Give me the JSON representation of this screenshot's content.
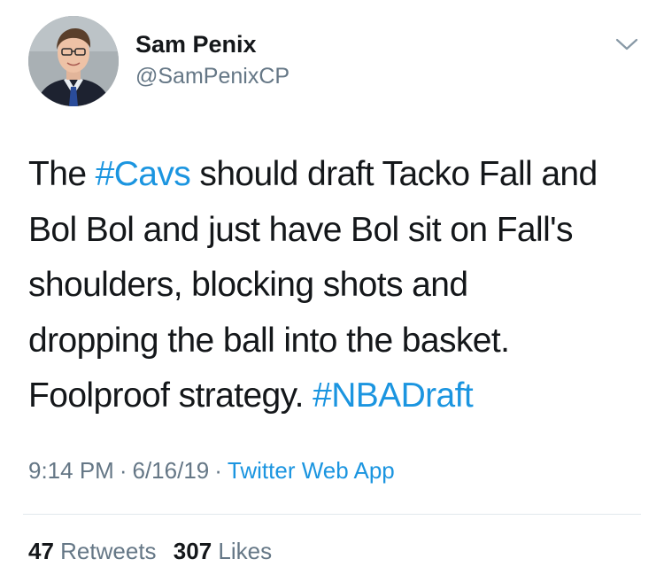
{
  "author": {
    "display_name": "Sam Penix",
    "handle": "@SamPenixCP",
    "avatar_icon": "profile-photo"
  },
  "menu": {
    "icon": "chevron-down-icon"
  },
  "tweet": {
    "lines": [
      [
        {
          "t": "The "
        },
        {
          "t": "#Cavs",
          "tag": true
        },
        {
          "t": " should draft Tacko Fall and"
        }
      ],
      [
        {
          "t": "Bol Bol and just have Bol sit on Fall's"
        }
      ],
      [
        {
          "t": "shoulders, blocking shots and"
        }
      ],
      [
        {
          "t": "dropping the ball into the basket."
        }
      ],
      [
        {
          "t": "Foolproof strategy. "
        },
        {
          "t": "#NBADraft",
          "tag": true
        }
      ]
    ]
  },
  "meta": {
    "time": "9:14 PM",
    "date": "6/16/19",
    "separator": "·",
    "source": "Twitter Web App"
  },
  "stats": {
    "retweets_count": "47",
    "retweets_label": "Retweets",
    "likes_count": "307",
    "likes_label": "Likes"
  },
  "colors": {
    "link": "#1b95e0",
    "secondary_text": "#657786",
    "primary_text": "#14171a",
    "divider": "#e1e8ed"
  }
}
